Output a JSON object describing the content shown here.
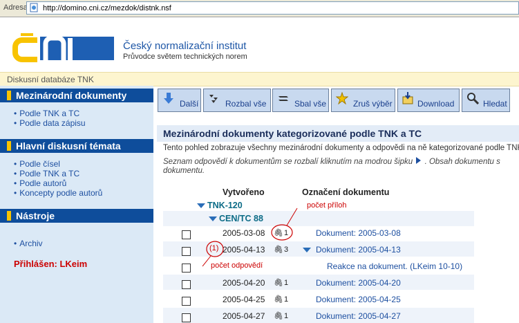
{
  "browser": {
    "address_label": "Adresa",
    "url": "http://domino.cni.cz/mezdok/distnk.nsf"
  },
  "header": {
    "institute_name": "Český normalizační institut",
    "institute_sub": "Průvodce světem technických norem",
    "database_name": "Diskusní databáze TNK"
  },
  "sidebar": {
    "sections": [
      {
        "title": "Mezinárodní dokumenty",
        "links": [
          "Podle TNK a TC",
          "Podle data zápisu"
        ]
      },
      {
        "title": "Hlavní diskusní témata",
        "links": [
          "Podle čísel",
          "Podle TNK a TC",
          "Podle autorů",
          "Koncepty podle autorů"
        ]
      },
      {
        "title": "Nástroje",
        "links": [
          "Archiv"
        ]
      }
    ],
    "login": "Přihlášen: LKeim"
  },
  "toolbar": {
    "buttons": [
      {
        "label": "Další",
        "icon": "arrow-down-icon"
      },
      {
        "label": "Rozbal vše",
        "icon": "expand-all-icon"
      },
      {
        "label": "Sbal vše",
        "icon": "collapse-all-icon"
      },
      {
        "label": "Zruš výběr",
        "icon": "clear-selection-icon"
      },
      {
        "label": "Download",
        "icon": "download-icon"
      },
      {
        "label": "Hledat",
        "icon": "search-icon"
      }
    ]
  },
  "content": {
    "title": "Mezinárodní dokumenty kategorizované podle TNK a TC",
    "desc1": "Tento pohled zobrazuje všechny mezinárodní dokumenty a odpovědi na ně kategorizované podle TNK",
    "desc2a": "Seznam odpovědí k dokumentům se rozbalí kliknutím na modrou šipku",
    "desc2b": ". Obsah dokumentu s",
    "desc3": "dokumentu.",
    "col_created": "Vytvořeno",
    "col_doc": "Označení dokumentu",
    "category1": "TNK-120",
    "category2": "CEN/TC 88",
    "rows": [
      {
        "date": "2005-03-08",
        "attachments": "1",
        "doc": "Dokument: 2005-03-08",
        "expandable": false
      },
      {
        "date": "2005-04-13",
        "attachments": "3",
        "doc": "Dokument: 2005-04-13",
        "expandable": true,
        "responses": "(1)"
      },
      {
        "date": "",
        "attachments": "",
        "doc": "Reakce na dokument. (LKeim 10-10)",
        "expandable": false,
        "is_response": true
      },
      {
        "date": "2005-04-20",
        "attachments": "1",
        "doc": "Dokument: 2005-04-20",
        "expandable": false
      },
      {
        "date": "2005-04-25",
        "attachments": "1",
        "doc": "Dokument: 2005-04-25",
        "expandable": false
      },
      {
        "date": "2005-04-27",
        "attachments": "1",
        "doc": "Dokument: 2005-04-27",
        "expandable": false
      }
    ],
    "annotations": {
      "attachments_note": "počet příloh",
      "responses_note": "počet odpovědí"
    }
  },
  "colors": {
    "sidebar_bg": "#dbe9f6",
    "section_head": "#0e4d9b",
    "accent_yellow": "#f8c300",
    "link": "#1d4fa0",
    "login": "#cc0000"
  }
}
